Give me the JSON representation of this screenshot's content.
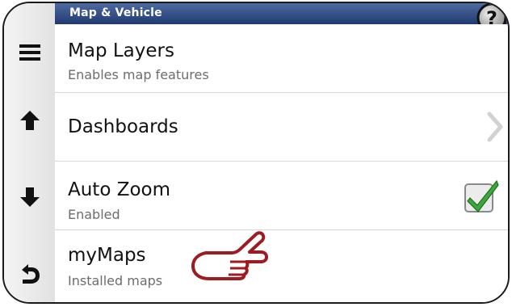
{
  "header": {
    "title": "Map & Vehicle"
  },
  "sidebar": {
    "items": [
      {
        "icon": "menu-icon"
      },
      {
        "icon": "arrow-up-icon"
      },
      {
        "icon": "arrow-down-icon"
      },
      {
        "icon": "back-icon"
      }
    ]
  },
  "help": {
    "icon": "help-icon",
    "label": "?"
  },
  "list": {
    "items": [
      {
        "title": "Map Layers",
        "subtitle": "Enables map features"
      },
      {
        "title": "Dashboards"
      },
      {
        "title": "Auto Zoom",
        "subtitle": "Enabled",
        "checked": true
      },
      {
        "title": "myMaps",
        "subtitle": "Installed maps"
      }
    ]
  },
  "colors": {
    "header": "#2a4478",
    "check": "#3aa83a",
    "pointer": "#9c1c22"
  }
}
